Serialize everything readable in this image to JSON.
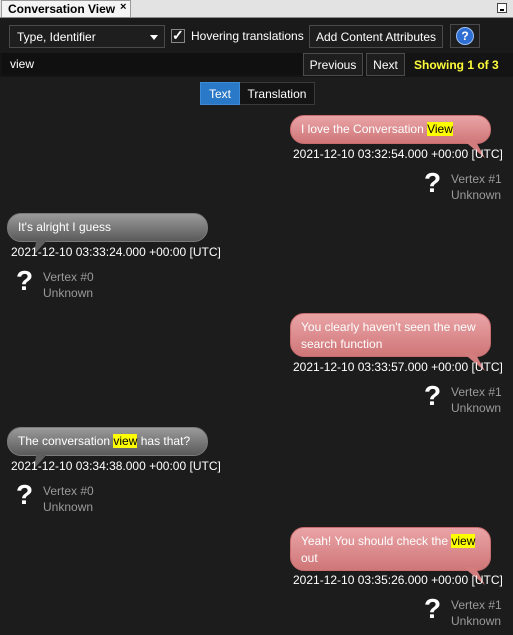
{
  "tab": {
    "title": "Conversation View",
    "close": "×"
  },
  "toolbar": {
    "dropdown_value": "Type, Identifier",
    "hover_checkbox_label": "Hovering translations",
    "hover_checked": true,
    "add_attributes_label": "Add Content Attributes",
    "help_symbol": "?"
  },
  "search": {
    "value": "view",
    "previous_label": "Previous",
    "next_label": "Next",
    "status": "Showing 1 of 3"
  },
  "mode": {
    "text_label": "Text",
    "translation_label": "Translation",
    "selected": "Text"
  },
  "messages": [
    {
      "side": "right",
      "before": "I love the Conversation ",
      "highlight": "View",
      "after": "",
      "timestamp": "2021-12-10 03:32:54.000 +00:00 [UTC]",
      "icon": "?",
      "vertex": "Vertex #1",
      "type": "Unknown"
    },
    {
      "side": "left",
      "before": "It's alright I guess",
      "highlight": "",
      "after": "",
      "timestamp": "2021-12-10 03:33:24.000 +00:00 [UTC]",
      "icon": "?",
      "vertex": "Vertex #0",
      "type": "Unknown"
    },
    {
      "side": "right",
      "before": "You clearly haven't seen the new search function",
      "highlight": "",
      "after": "",
      "timestamp": "2021-12-10 03:33:57.000 +00:00 [UTC]",
      "icon": "?",
      "vertex": "Vertex #1",
      "type": "Unknown"
    },
    {
      "side": "left",
      "before": "The conversation ",
      "highlight": "view",
      "after": " has that?",
      "timestamp": "2021-12-10 03:34:38.000 +00:00 [UTC]",
      "icon": "?",
      "vertex": "Vertex #0",
      "type": "Unknown"
    },
    {
      "side": "right",
      "before": "Yeah! You should check the ",
      "highlight": "view",
      "after": " out",
      "timestamp": "2021-12-10 03:35:26.000 +00:00 [UTC]",
      "icon": "?",
      "vertex": "Vertex #1",
      "type": "Unknown"
    }
  ],
  "colors": {
    "highlight": "#ffff00",
    "status": "#ffff3a",
    "selected_tab": "#2a78c8",
    "right_bubble": "#e49a9c",
    "left_bubble": "#7a7a7a"
  }
}
